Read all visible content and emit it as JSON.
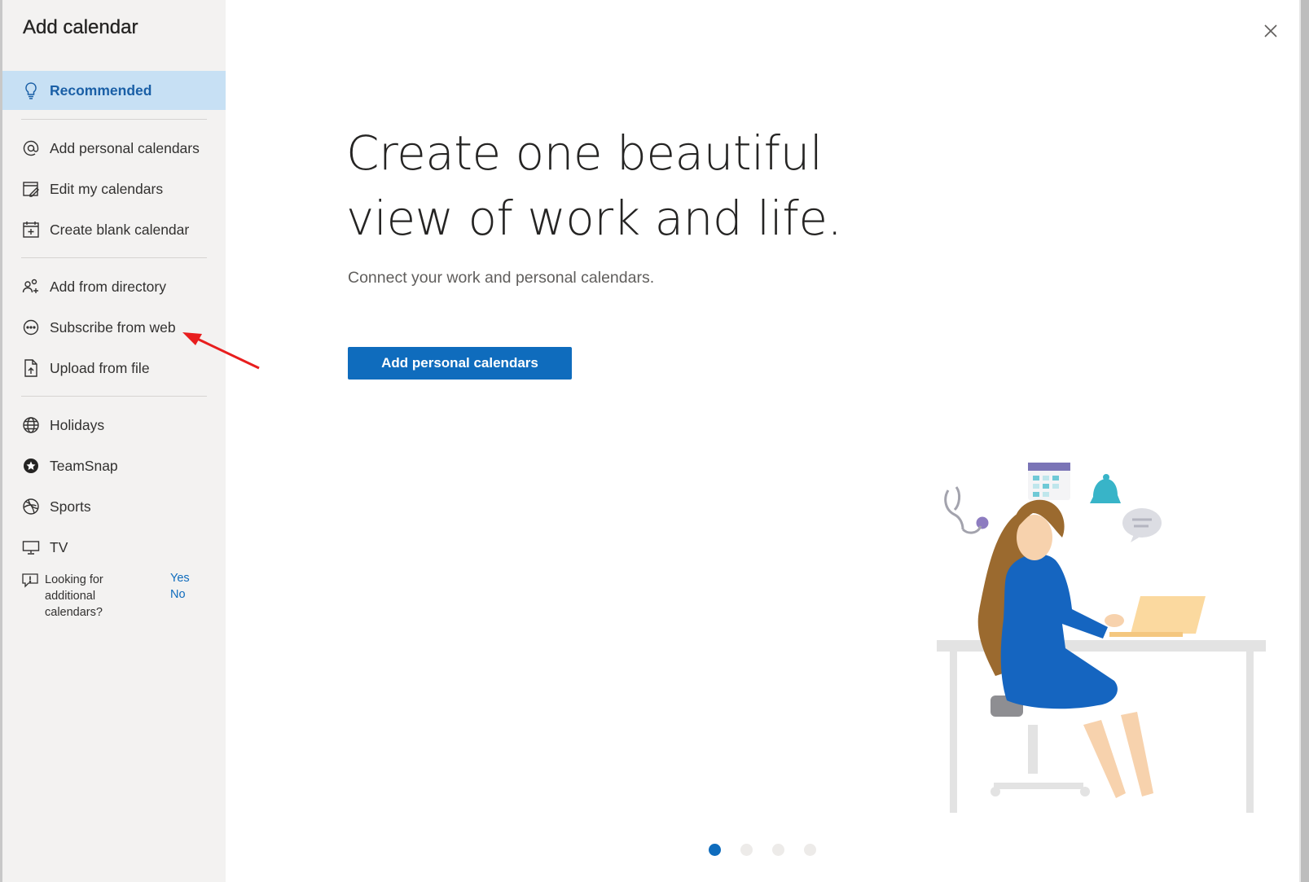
{
  "sidebar": {
    "title": "Add calendar",
    "items": [
      {
        "label": "Recommended",
        "icon": "lightbulb-icon",
        "selected": true
      },
      {
        "label": "Add personal calendars",
        "icon": "at-sign-icon"
      },
      {
        "label": "Edit my calendars",
        "icon": "edit-calendar-icon"
      },
      {
        "label": "Create blank calendar",
        "icon": "calendar-add-icon"
      },
      {
        "label": "Add from directory",
        "icon": "people-add-icon"
      },
      {
        "label": "Subscribe from web",
        "icon": "web-subscribe-icon"
      },
      {
        "label": "Upload from file",
        "icon": "file-upload-icon"
      },
      {
        "label": "Holidays",
        "icon": "globe-icon"
      },
      {
        "label": "TeamSnap",
        "icon": "teamsnap-icon"
      },
      {
        "label": "Sports",
        "icon": "sports-ball-icon"
      },
      {
        "label": "TV",
        "icon": "tv-icon"
      }
    ],
    "feedback": {
      "question": "Looking for additional calendars?",
      "yes": "Yes",
      "no": "No"
    }
  },
  "main": {
    "headline": "Create one beautiful view of work and life.",
    "subtext": "Connect your work and personal calendars.",
    "button_label": "Add personal calendars",
    "carousel": {
      "count": 4,
      "active": 1
    }
  },
  "colors": {
    "accent": "#0f6cbd",
    "selected_bg": "#c7e0f4",
    "sidebar_bg": "#f3f2f1",
    "annotation_arrow": "#e81e1e"
  }
}
